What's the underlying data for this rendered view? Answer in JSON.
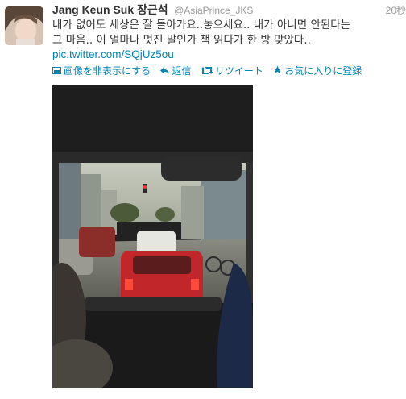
{
  "tweet": {
    "fullname": "Jang Keun Suk 장근석",
    "screen_name": "@AsiaPrince_JKS",
    "timestamp": "20秒",
    "text_line1": "내가 없어도 세상은 잘 돌아가요..놓으세요.. 내가 아니면 안된다는",
    "text_line2": "그 마음.. 이 얼마나 멋진 말인가 책 읽다가 한 방 맞았다..",
    "link": "pic.twitter.com/SQjUz5ou"
  },
  "actions": {
    "hide_media": "画像を非表示にする",
    "reply": "返信",
    "retweet": "リツイート",
    "favorite": "お気に入りに登録"
  },
  "icons": {
    "hide_media": "image-icon",
    "reply": "reply-arrow-icon",
    "retweet": "retweet-icon",
    "favorite": "star-icon"
  },
  "colors": {
    "link": "#0084b4",
    "meta": "#999999",
    "text": "#333333"
  }
}
